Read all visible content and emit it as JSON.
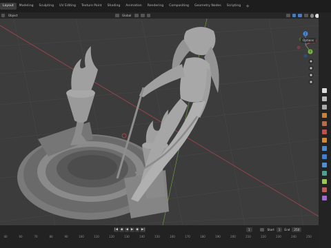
{
  "workspace_tabs": [
    "Layout",
    "Modeling",
    "Sculpting",
    "UV Editing",
    "Texture Paint",
    "Shading",
    "Animation",
    "Rendering",
    "Compositing",
    "Geometry Nodes",
    "Scripting"
  ],
  "active_tab": "Layout",
  "tab_add": "+",
  "header": {
    "menu_object": "Object",
    "transform_orientation": "Global"
  },
  "viewport": {
    "options_label": "Options",
    "axis_gizmo": {
      "x": "X",
      "y": "Y",
      "z": "Z"
    },
    "colors": {
      "grid": "#444444",
      "x_axis": "#a8454f",
      "y_axis": "#6f9a3e",
      "background": "#3c3c3c",
      "model": "#9c9c9c"
    }
  },
  "timeline": {
    "current_frame": "1",
    "start_label": "Start",
    "start_value": "1",
    "end_label": "End",
    "end_value": "250",
    "ruler_ticks": [
      "40",
      "60",
      "70",
      "80",
      "90",
      "100",
      "110",
      "120",
      "130",
      "140",
      "150",
      "160",
      "170",
      "180",
      "190",
      "200",
      "210",
      "220",
      "230",
      "240",
      "250"
    ]
  }
}
